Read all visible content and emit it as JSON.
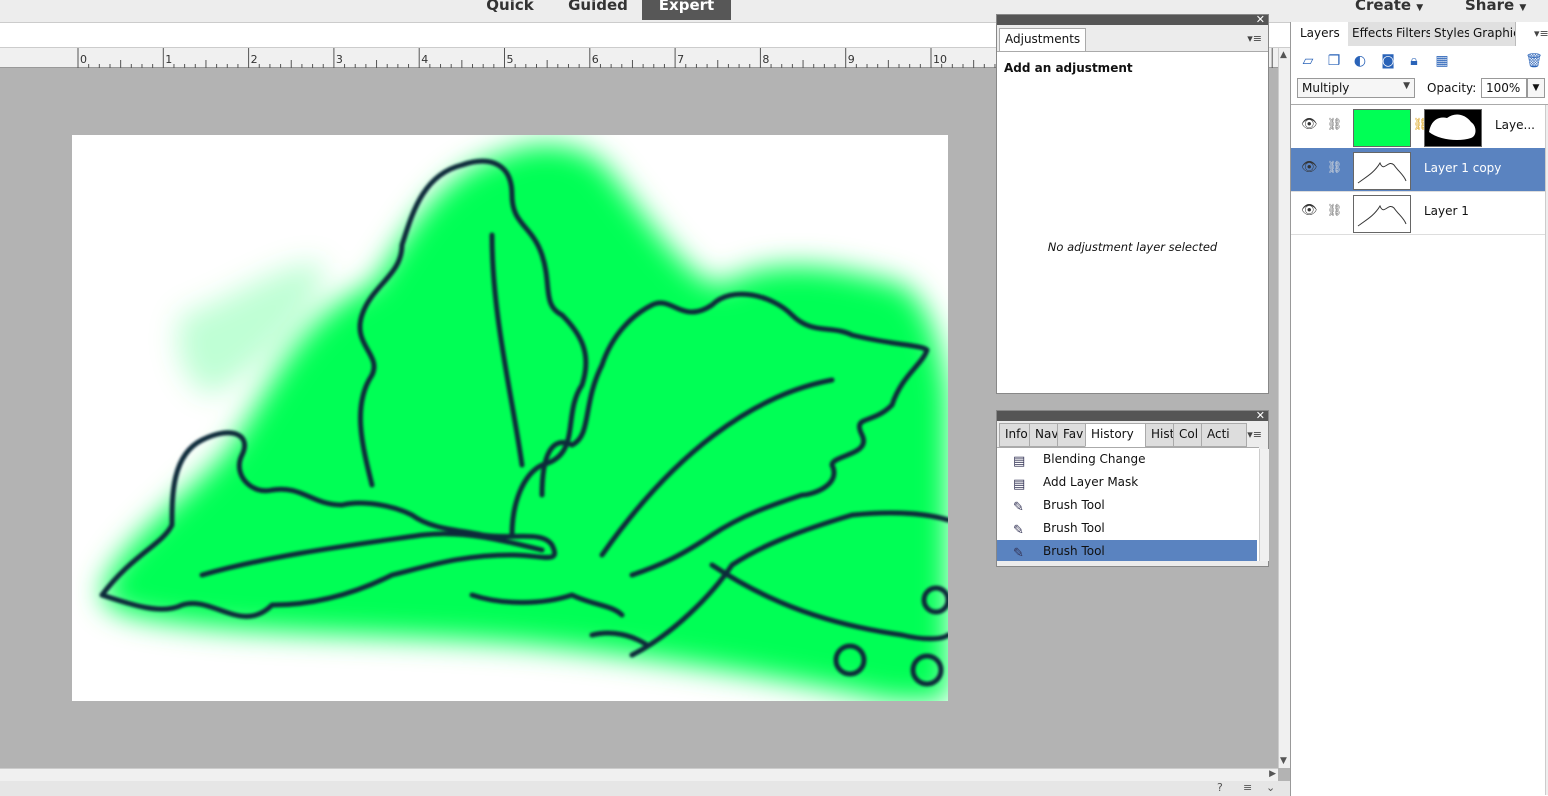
{
  "modes": [
    {
      "label": "Quick",
      "active": false
    },
    {
      "label": "Guided",
      "active": false
    },
    {
      "label": "Expert",
      "active": true
    }
  ],
  "top_right": {
    "create": "Create",
    "share": "Share"
  },
  "ruler_labels": [
    "0",
    "1",
    "2",
    "3",
    "4",
    "5",
    "6",
    "7",
    "8",
    "9",
    "10"
  ],
  "adjustments_panel": {
    "tab": "Adjustments",
    "heading": "Add an adjustment",
    "empty_message": "No adjustment layer selected"
  },
  "history_panel": {
    "tabs": [
      "Info",
      "Nav",
      "Fav",
      "History",
      "Hist",
      "Col",
      "Acti"
    ],
    "active_tab": "History",
    "items": [
      {
        "label": "Blending Change",
        "icon": "document-icon",
        "selected": false
      },
      {
        "label": "Add Layer Mask",
        "icon": "document-icon",
        "selected": false
      },
      {
        "label": "Brush Tool",
        "icon": "brush-icon",
        "selected": false
      },
      {
        "label": "Brush Tool",
        "icon": "brush-icon",
        "selected": false
      },
      {
        "label": "Brush Tool",
        "icon": "brush-icon",
        "selected": true
      }
    ]
  },
  "layers_panel": {
    "tabs": [
      "Layers",
      "Effects",
      "Filters",
      "Styles",
      "Graphics"
    ],
    "active_tab": "Layers",
    "blend_mode": "Multiply",
    "opacity_label": "Opacity:",
    "opacity_value": "100%",
    "layers": [
      {
        "name": "Laye...",
        "thumb_color": "#00ff55",
        "has_mask": true,
        "selected": false
      },
      {
        "name": "Layer 1 copy",
        "thumb_color": "#ffffff",
        "has_mask": false,
        "selected": true
      },
      {
        "name": "Layer 1",
        "thumb_color": "#ffffff",
        "has_mask": false,
        "selected": false
      }
    ]
  },
  "colors": {
    "accent_selection": "#5a83c0",
    "paint_green": "#00ff55",
    "outline": "#0e2a3a"
  }
}
